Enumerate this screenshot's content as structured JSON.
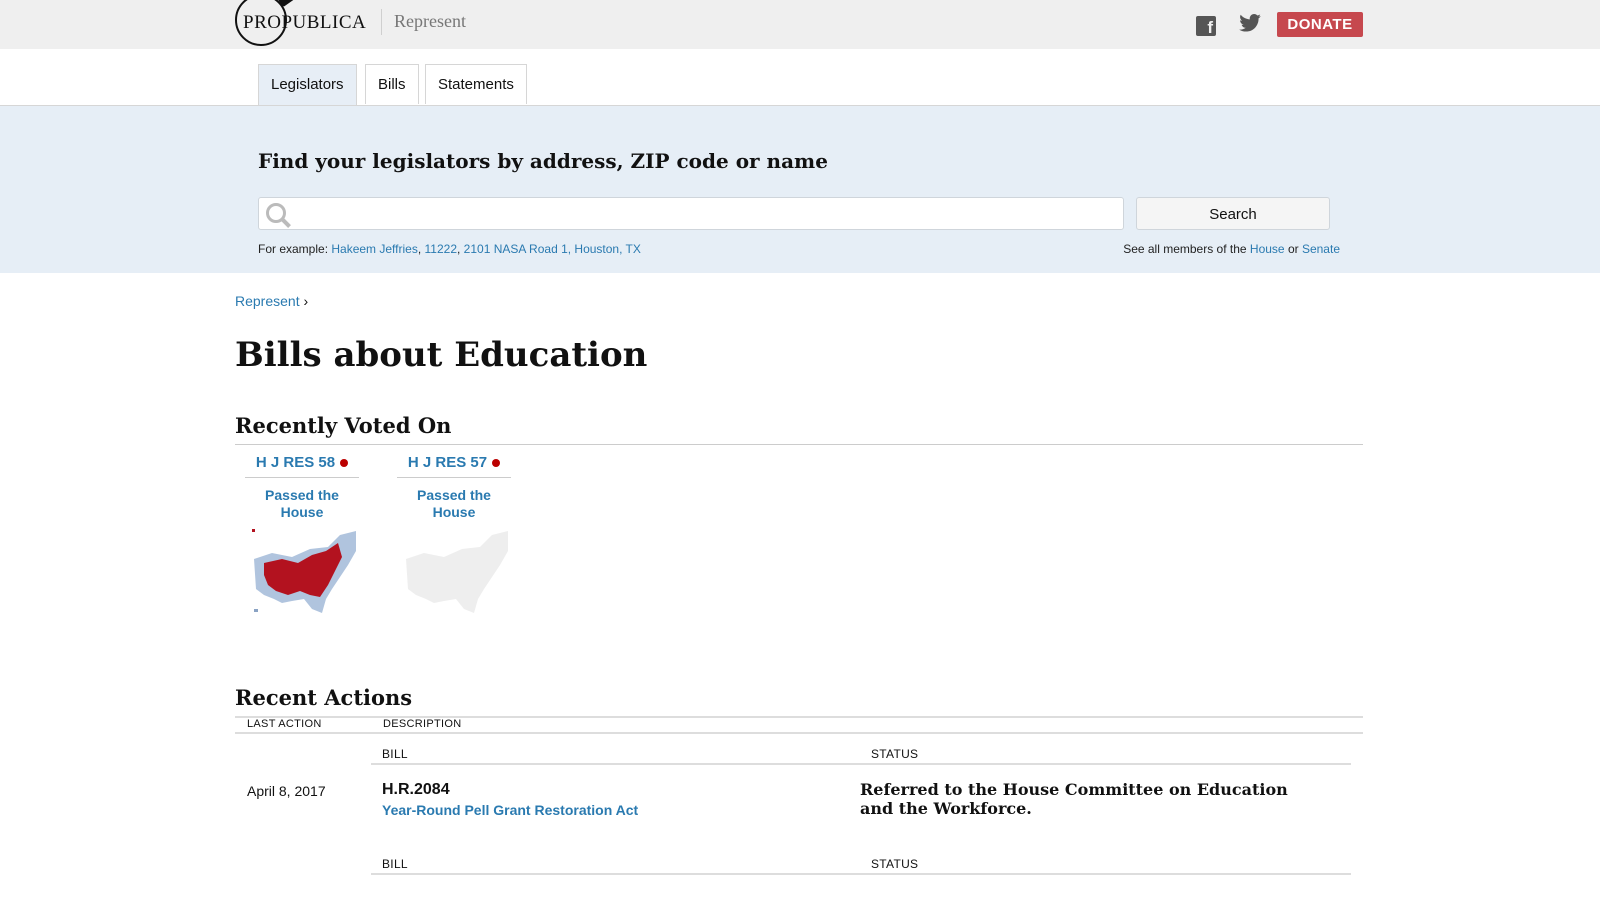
{
  "header": {
    "logo_text": "PROPUBLICA",
    "section": "Represent",
    "facebook_icon": "f",
    "twitter_icon": "🐦",
    "donate_label": "DONATE"
  },
  "tabs": [
    {
      "label": "Legislators",
      "active": true
    },
    {
      "label": "Bills",
      "active": false
    },
    {
      "label": "Statements",
      "active": false
    }
  ],
  "search": {
    "title": "Find your legislators by address, ZIP code or name",
    "placeholder": "",
    "button_label": "Search",
    "example_prefix": "For example: ",
    "examples": [
      "Hakeem Jeffries",
      "11222",
      "2101 NASA Road 1, Houston, TX"
    ],
    "see_all_prefix": "See all members of the ",
    "house_link": "House",
    "or_text": " or ",
    "senate_link": "Senate"
  },
  "breadcrumb": {
    "label": "Represent",
    "sep": "›"
  },
  "page_title": "Bills about Education",
  "recently_voted": {
    "heading": "Recently Voted On",
    "cards": [
      {
        "bill_id": "H J RES 58",
        "result_line1": "Passed the",
        "result_line2": "House"
      },
      {
        "bill_id": "H J RES 57",
        "result_line1": "Passed the",
        "result_line2": "House"
      }
    ]
  },
  "recent_actions": {
    "heading": "Recent Actions",
    "col_last_action": "LAST ACTION",
    "col_description": "DESCRIPTION",
    "rows": [
      {
        "date": "April 8, 2017",
        "bill_header": "BILL",
        "status_header": "STATUS",
        "bill_number": "H.R.2084",
        "bill_title": "Year-Round Pell Grant Restoration Act",
        "status": "Referred to the House Committee on Education and the Workforce."
      },
      {
        "date": "",
        "bill_header": "BILL",
        "status_header": "STATUS",
        "bill_number": "",
        "bill_title": "",
        "status": ""
      }
    ]
  },
  "colors": {
    "accent": "#2a7ab0",
    "donate": "#c6484e",
    "search_band": "#e6eef6",
    "vote_dot": "#bb0000"
  }
}
